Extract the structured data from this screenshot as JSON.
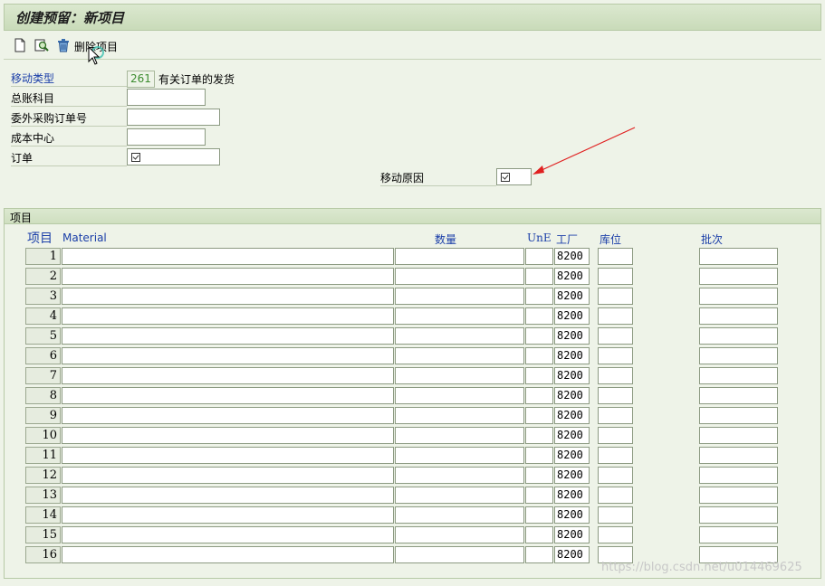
{
  "window": {
    "title": "创建预留：新项目"
  },
  "toolbar": {
    "delete_item_label": "删除项目"
  },
  "header_fields": {
    "movement_type_label": "移动类型",
    "movement_type_value": "261",
    "movement_type_desc": "有关订单的发货",
    "gl_account_label": "总账科目",
    "gl_account_value": "",
    "subcontract_po_label": "委外采购订单号",
    "subcontract_po_value": "",
    "cost_center_label": "成本中心",
    "cost_center_value": "",
    "order_label": "订单",
    "order_value": "",
    "movement_reason_label": "移动原因",
    "movement_reason_value": ""
  },
  "items_section": {
    "title": "项目",
    "columns": {
      "item": "项目",
      "material": "Material",
      "quantity": "数量",
      "unit": "UnE",
      "plant": "工厂",
      "storage_location": "库位",
      "batch": "批次"
    },
    "rows": [
      {
        "item": "1",
        "plant": "8200"
      },
      {
        "item": "2",
        "plant": "8200"
      },
      {
        "item": "3",
        "plant": "8200"
      },
      {
        "item": "4",
        "plant": "8200"
      },
      {
        "item": "5",
        "plant": "8200"
      },
      {
        "item": "6",
        "plant": "8200"
      },
      {
        "item": "7",
        "plant": "8200"
      },
      {
        "item": "8",
        "plant": "8200"
      },
      {
        "item": "9",
        "plant": "8200"
      },
      {
        "item": "10",
        "plant": "8200"
      },
      {
        "item": "11",
        "plant": "8200"
      },
      {
        "item": "12",
        "plant": "8200"
      },
      {
        "item": "13",
        "plant": "8200"
      },
      {
        "item": "14",
        "plant": "8200"
      },
      {
        "item": "15",
        "plant": "8200"
      },
      {
        "item": "16",
        "plant": "8200"
      }
    ]
  },
  "watermark": "https://blog.csdn.net/u014469625",
  "colors": {
    "label_blue": "#1a3ea8",
    "annotation_arrow": "#e02020",
    "readonly_value": "#3b8b2e"
  }
}
